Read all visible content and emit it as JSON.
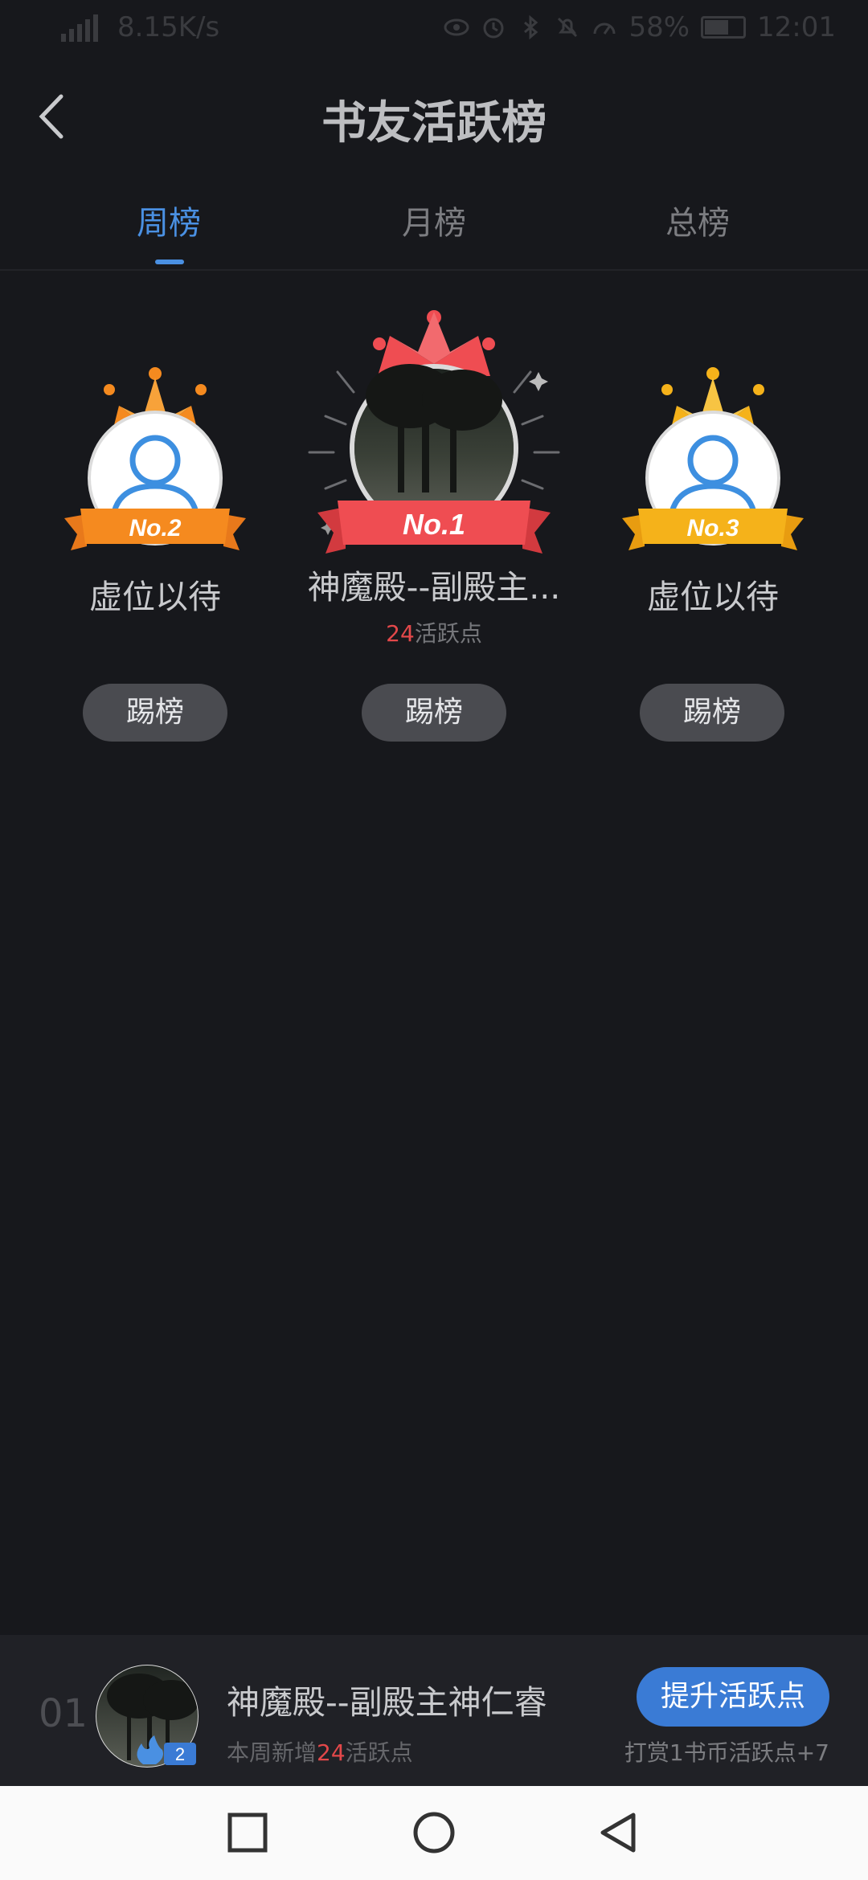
{
  "status_bar": {
    "network_type": "4G",
    "speed": "8.15K/s",
    "battery": "58%",
    "time": "12:01",
    "icons": [
      "eye-icon",
      "alarm-icon",
      "bluetooth-icon",
      "mute-icon",
      "speed-icon",
      "battery-icon"
    ]
  },
  "header": {
    "title": "书友活跃榜"
  },
  "tabs": [
    {
      "label": "周榜",
      "active": true
    },
    {
      "label": "月榜",
      "active": false
    },
    {
      "label": "总榜",
      "active": false
    }
  ],
  "podium": {
    "first": {
      "badge": "No.1",
      "name": "神魔殿--副殿主...",
      "points_value": "24",
      "points_suffix": "活跃点",
      "button": "踢榜"
    },
    "second": {
      "badge": "No.2",
      "name": "虚位以待",
      "button": "踢榜"
    },
    "third": {
      "badge": "No.3",
      "name": "虚位以待",
      "button": "踢榜"
    }
  },
  "my_rank": {
    "rank": "01",
    "name": "神魔殿--副殿主神仁睿",
    "level": "2",
    "sub_prefix": "本周新增",
    "sub_value": "24",
    "sub_suffix": "活跃点",
    "button": "提升活跃点",
    "tip": "打赏1书币活跃点+7"
  },
  "colors": {
    "accent": "#4a90e2",
    "red": "#e3484a",
    "gold": "#f5a623",
    "orange": "#f58a1f"
  }
}
